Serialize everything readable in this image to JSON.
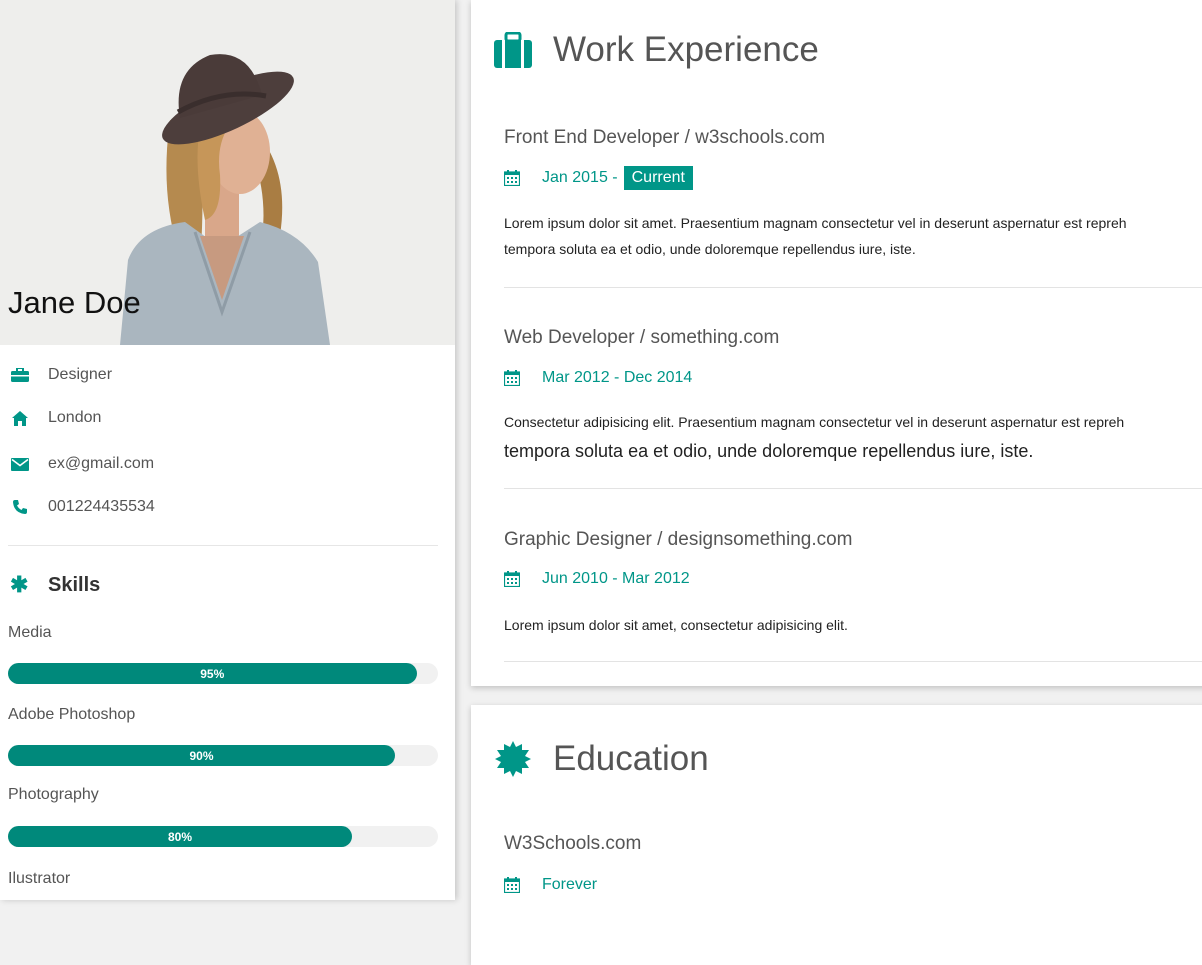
{
  "profile": {
    "name": "Jane Doe",
    "info": [
      {
        "icon": "briefcase-icon",
        "text": "Designer"
      },
      {
        "icon": "home-icon",
        "text": "London"
      },
      {
        "icon": "envelope-icon",
        "text": "ex@gmail.com"
      },
      {
        "icon": "phone-icon",
        "text": "001224435534"
      }
    ]
  },
  "skills": {
    "title": "Skills",
    "icon": "asterisk-icon",
    "items": [
      {
        "name": "Media",
        "percent": 95,
        "label": "95%"
      },
      {
        "name": "Adobe Photoshop",
        "percent": 90,
        "label": "90%"
      },
      {
        "name": "Photography",
        "percent": 80,
        "label": "80%"
      },
      {
        "name": "Ilustrator",
        "percent": null,
        "label": ""
      }
    ]
  },
  "work": {
    "title": "Work Experience",
    "icon": "suitcase-icon",
    "jobs": [
      {
        "title": "Front End Developer / w3schools.com",
        "date": "Jan 2015 -",
        "badge": "Current",
        "desc1": "Lorem ipsum dolor sit amet. Praesentium magnam consectetur vel in deserunt aspernatur est repreh",
        "desc2": "tempora soluta ea et odio, unde doloremque repellendus iure, iste."
      },
      {
        "title": "Web Developer / something.com",
        "date": "Mar 2012 - Dec 2014",
        "badge": "",
        "desc1": "Consectetur adipisicing elit. Praesentium magnam consectetur vel in deserunt aspernatur est repreh",
        "desc2": "tempora soluta ea et odio, unde doloremque repellendus iure, iste."
      },
      {
        "title": "Graphic Designer / designsomething.com",
        "date": "Jun 2010 - Mar 2012",
        "badge": "",
        "desc1": "Lorem ipsum dolor sit amet, consectetur adipisicing elit.",
        "desc2": ""
      }
    ]
  },
  "education": {
    "title": "Education",
    "icon": "certificate-icon",
    "items": [
      {
        "school": "W3Schools.com",
        "date": "Forever"
      }
    ]
  },
  "colors": {
    "accent": "#009688",
    "bar_track": "#f1f1f1",
    "page_bg": "#f1f1f1"
  }
}
